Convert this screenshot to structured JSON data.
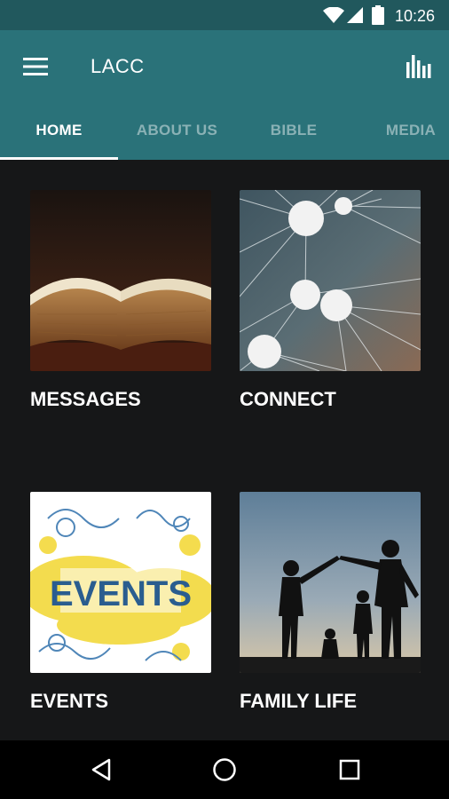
{
  "status_bar": {
    "time": "10:26",
    "icons": [
      "wifi-icon",
      "cell-signal-icon",
      "battery-icon"
    ]
  },
  "app_bar": {
    "title": "LACC",
    "menu_icon": "hamburger-menu-icon",
    "action_icon": "bar-chart-icon",
    "background_color": "#2a7279"
  },
  "tabs": [
    {
      "label": "HOME",
      "active": true
    },
    {
      "label": "ABOUT US",
      "active": false
    },
    {
      "label": "BIBLE",
      "active": false
    },
    {
      "label": "MEDIA",
      "active": false
    }
  ],
  "tiles": [
    {
      "label": "MESSAGES",
      "image": "open-bible-photo"
    },
    {
      "label": "CONNECT",
      "image": "network-nodes-photo"
    },
    {
      "label": "EVENTS",
      "image": "events-graphic",
      "image_text": "EVENTS"
    },
    {
      "label": "FAMILY LIFE",
      "image": "family-silhouette-photo"
    }
  ],
  "nav_bar": {
    "icons": [
      "back-icon",
      "home-icon",
      "recents-icon"
    ]
  }
}
